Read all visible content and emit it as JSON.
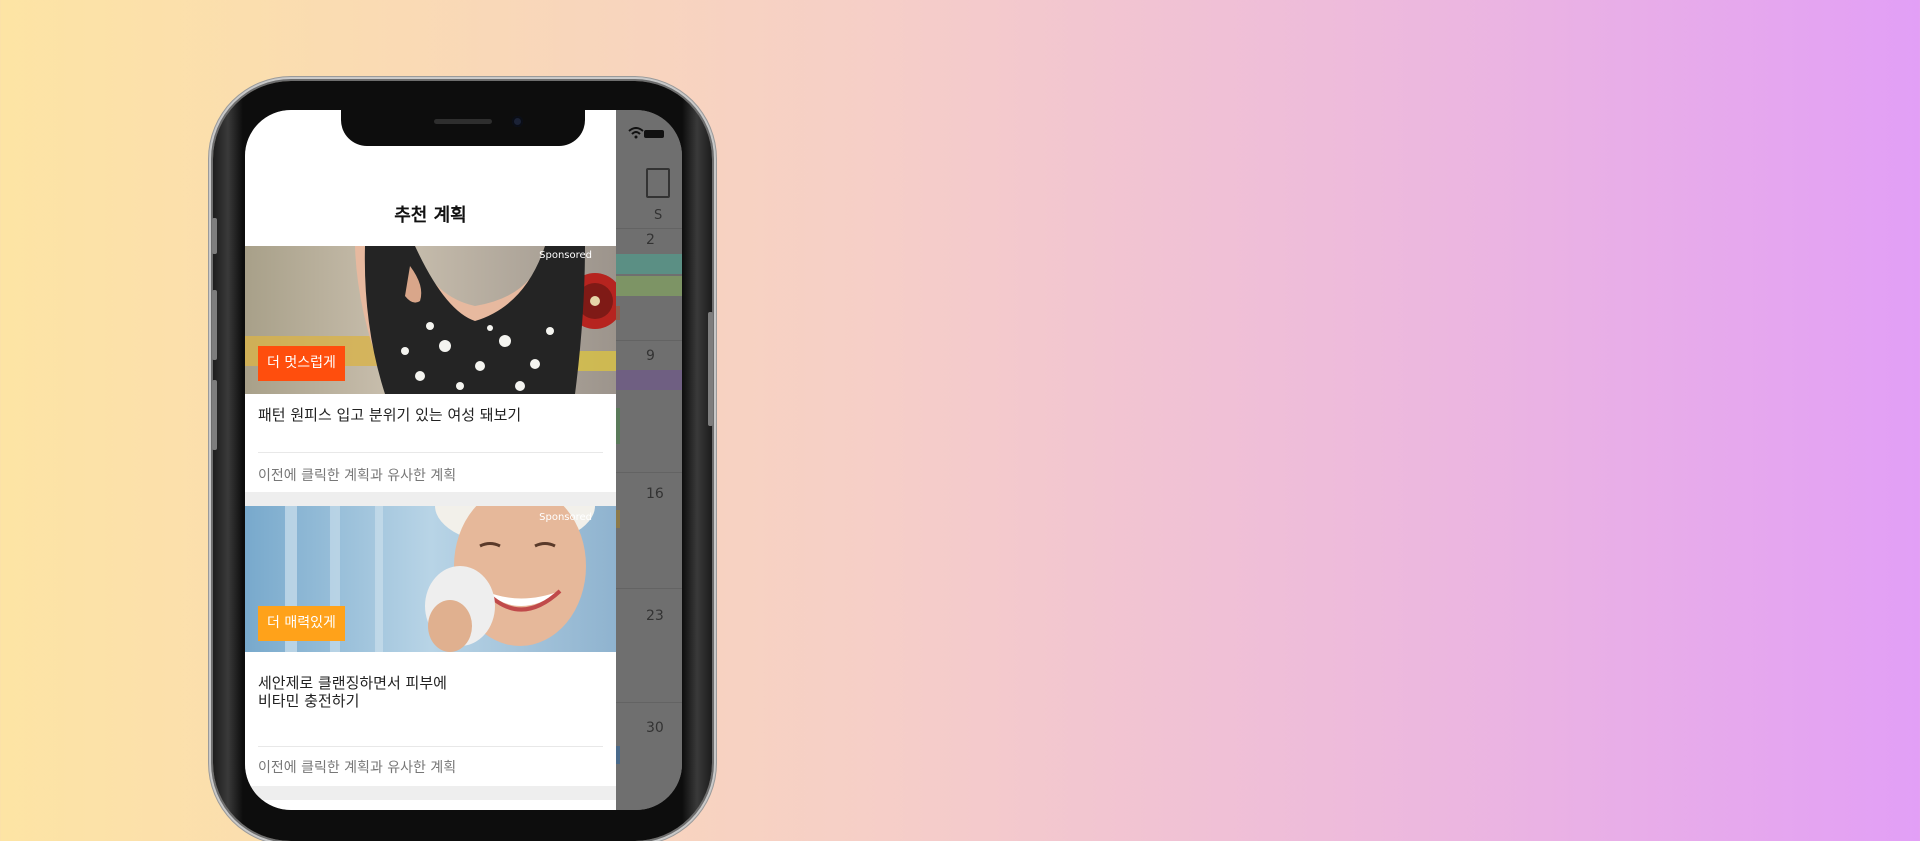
{
  "drawer": {
    "title": "추천 계획",
    "cards": [
      {
        "sponsored": "Sponsored",
        "tag": "더 멋스럽게",
        "tag_color": "#ff4e0d",
        "title_line1": "패턴 원피스 입고 분위기 있는 여성 돼보기",
        "title_line2": "",
        "footer": "이전에 클릭한 계획과 유사한 계획"
      },
      {
        "sponsored": "Sponsored",
        "tag": "더 매력있게",
        "tag_color": "#ffa21a",
        "title_line1": "세안제로 클랜징하면서 피부에",
        "title_line2": "비타민 충전하기",
        "footer": "이전에 클릭한 계획과 유사한 계획"
      }
    ]
  },
  "calendar": {
    "weekday": "S",
    "dates": [
      "2",
      "9",
      "16",
      "23",
      "30"
    ]
  }
}
